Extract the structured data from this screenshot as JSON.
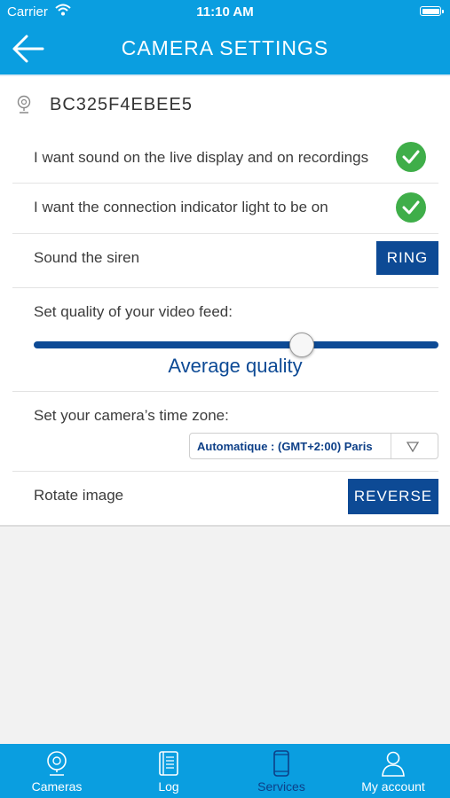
{
  "status": {
    "carrier": "Carrier",
    "time": "11:10 AM"
  },
  "header": {
    "title": "CAMERA SETTINGS",
    "back_icon": "arrow-left-icon"
  },
  "device": {
    "id": "BC325F4EBEE5",
    "icon": "microphone-icon"
  },
  "settings": {
    "sound": {
      "label": "I want sound on the live display and on recordings",
      "checked": true
    },
    "indicator": {
      "label": "I want the connection indicator light to be on",
      "checked": true
    },
    "siren": {
      "label": "Sound the siren",
      "button": "RING"
    },
    "quality": {
      "label": "Set quality of your video feed:",
      "value_text": "Average quality",
      "level": 0.66
    },
    "timezone": {
      "label": "Set your camera’s time zone:",
      "selected": "Automatique : (GMT+2:00) Paris"
    },
    "rotate": {
      "label": "Rotate image",
      "button": "REVERSE"
    }
  },
  "tabs": [
    {
      "label": "Cameras",
      "icon": "camera-icon",
      "active": false
    },
    {
      "label": "Log",
      "icon": "log-book-icon",
      "active": false
    },
    {
      "label": "Services",
      "icon": "phone-icon",
      "active": true
    },
    {
      "label": "My account",
      "icon": "user-icon",
      "active": false
    }
  ],
  "colors": {
    "header": "#0a9ee0",
    "accent": "#0d4a95",
    "check": "#3fae49"
  }
}
